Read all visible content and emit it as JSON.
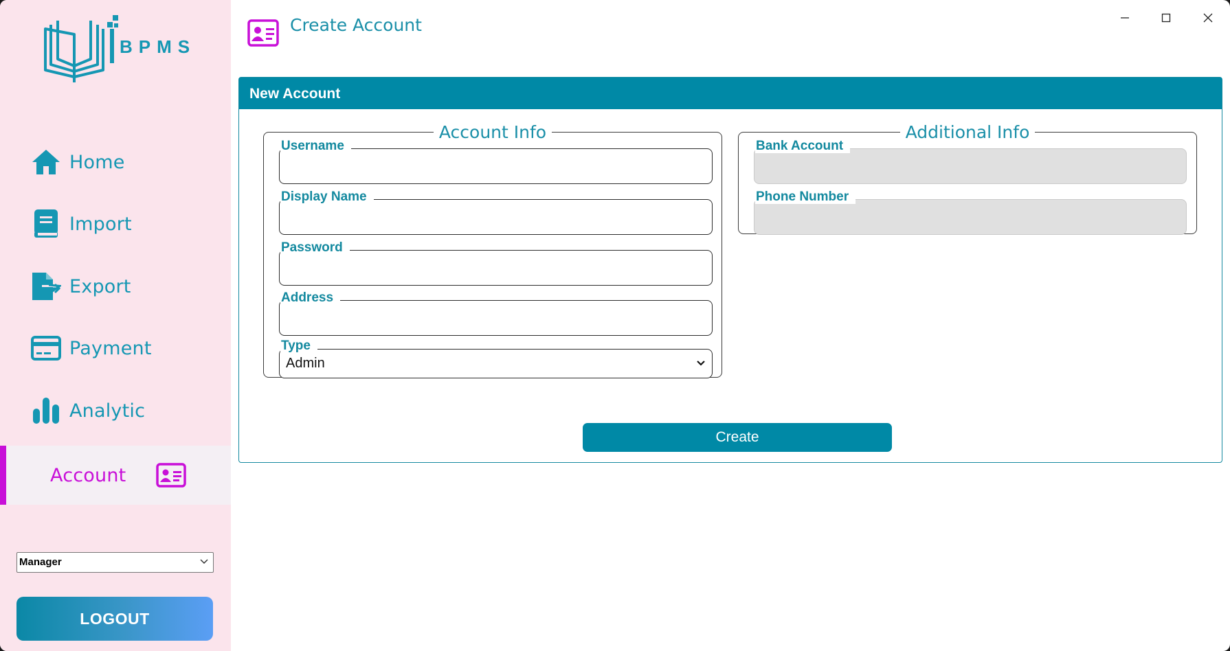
{
  "app": {
    "logo_text": "BPMS",
    "accent_color": "#0089a6",
    "active_color": "#c80fd8"
  },
  "sidebar": {
    "items": [
      {
        "label": "Home",
        "icon": "home-icon"
      },
      {
        "label": "Import",
        "icon": "book-icon"
      },
      {
        "label": "Export",
        "icon": "file-export-icon"
      },
      {
        "label": "Payment",
        "icon": "credit-card-icon"
      },
      {
        "label": "Analytic",
        "icon": "bar-chart-icon"
      },
      {
        "label": "Account",
        "icon": "id-card-icon",
        "active": true
      }
    ],
    "role_select": {
      "value": "Manager"
    },
    "logout_label": "LOGOUT"
  },
  "header": {
    "title": "Create Account",
    "icon": "id-card-icon"
  },
  "window_controls": [
    "minimize-icon",
    "maximize-icon",
    "close-icon"
  ],
  "panel": {
    "title": "New Account",
    "account_info": {
      "legend": "Account Info",
      "fields": {
        "username": {
          "label": "Username",
          "value": ""
        },
        "display_name": {
          "label": "Display Name",
          "value": ""
        },
        "password": {
          "label": "Password",
          "value": ""
        },
        "address": {
          "label": "Address",
          "value": ""
        },
        "type": {
          "label": "Type",
          "value": "Admin"
        }
      }
    },
    "additional_info": {
      "legend": "Additional Info",
      "fields": {
        "bank_account": {
          "label": "Bank Account",
          "value": "",
          "disabled": true
        },
        "phone_number": {
          "label": "Phone Number",
          "value": "",
          "disabled": true
        }
      }
    },
    "create_label": "Create"
  }
}
